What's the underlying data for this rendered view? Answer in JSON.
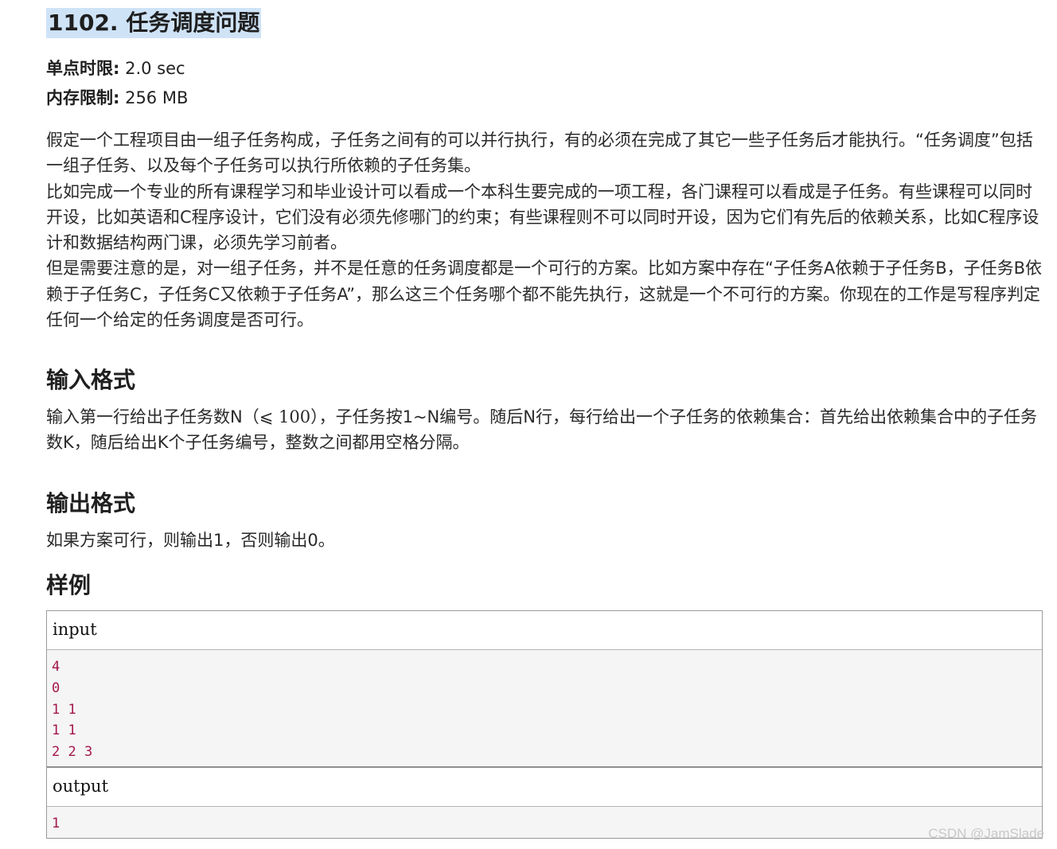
{
  "title": "1102. 任务调度问题",
  "limits": {
    "time_label": "单点时限:",
    "time_value": " 2.0 sec",
    "memory_label": "内存限制:",
    "memory_value": " 256 MB"
  },
  "description": {
    "p1": "假定一个工程项目由一组子任务构成，子任务之间有的可以并行执行，有的必须在完成了其它一些子任务后才能执行。“任务调度”包括一组子任务、以及每个子任务可以执行所依赖的子任务集。",
    "p2": "比如完成一个专业的所有课程学习和毕业设计可以看成一个本科生要完成的一项工程，各门课程可以看成是子任务。有些课程可以同时开设，比如英语和C程序设计，它们没有必须先修哪门的约束；有些课程则不可以同时开设，因为它们有先后的依赖关系，比如C程序设计和数据结构两门课，必须先学习前者。",
    "p3": "但是需要注意的是，对一组子任务，并不是任意的任务调度都是一个可行的方案。比如方案中存在“子任务A依赖于子任务B，子任务B依赖于子任务C，子任务C又依赖于子任务A”，那么这三个任务哪个都不能先执行，这就是一个不可行的方案。你现在的工作是写程序判定任何一个给定的任务调度是否可行。"
  },
  "input_section": {
    "heading": "输入格式",
    "text_before": "输入第一行给出子任务数N（",
    "math": "⩽ 100",
    "text_after": "），子任务按1~N编号。随后N行，每行给出一个子任务的依赖集合：首先给出依赖集合中的子任务数K，随后给出K个子任务编号，整数之间都用空格分隔。"
  },
  "output_section": {
    "heading": "输出格式",
    "text": "如果方案可行，则输出1，否则输出0。"
  },
  "sample_section": {
    "heading": "样例",
    "input_label": "input",
    "input_content": "4\n0\n1 1\n1 1\n2 2 3",
    "output_label": "output",
    "output_content": "1"
  },
  "watermark": "CSDN @JamSlade"
}
